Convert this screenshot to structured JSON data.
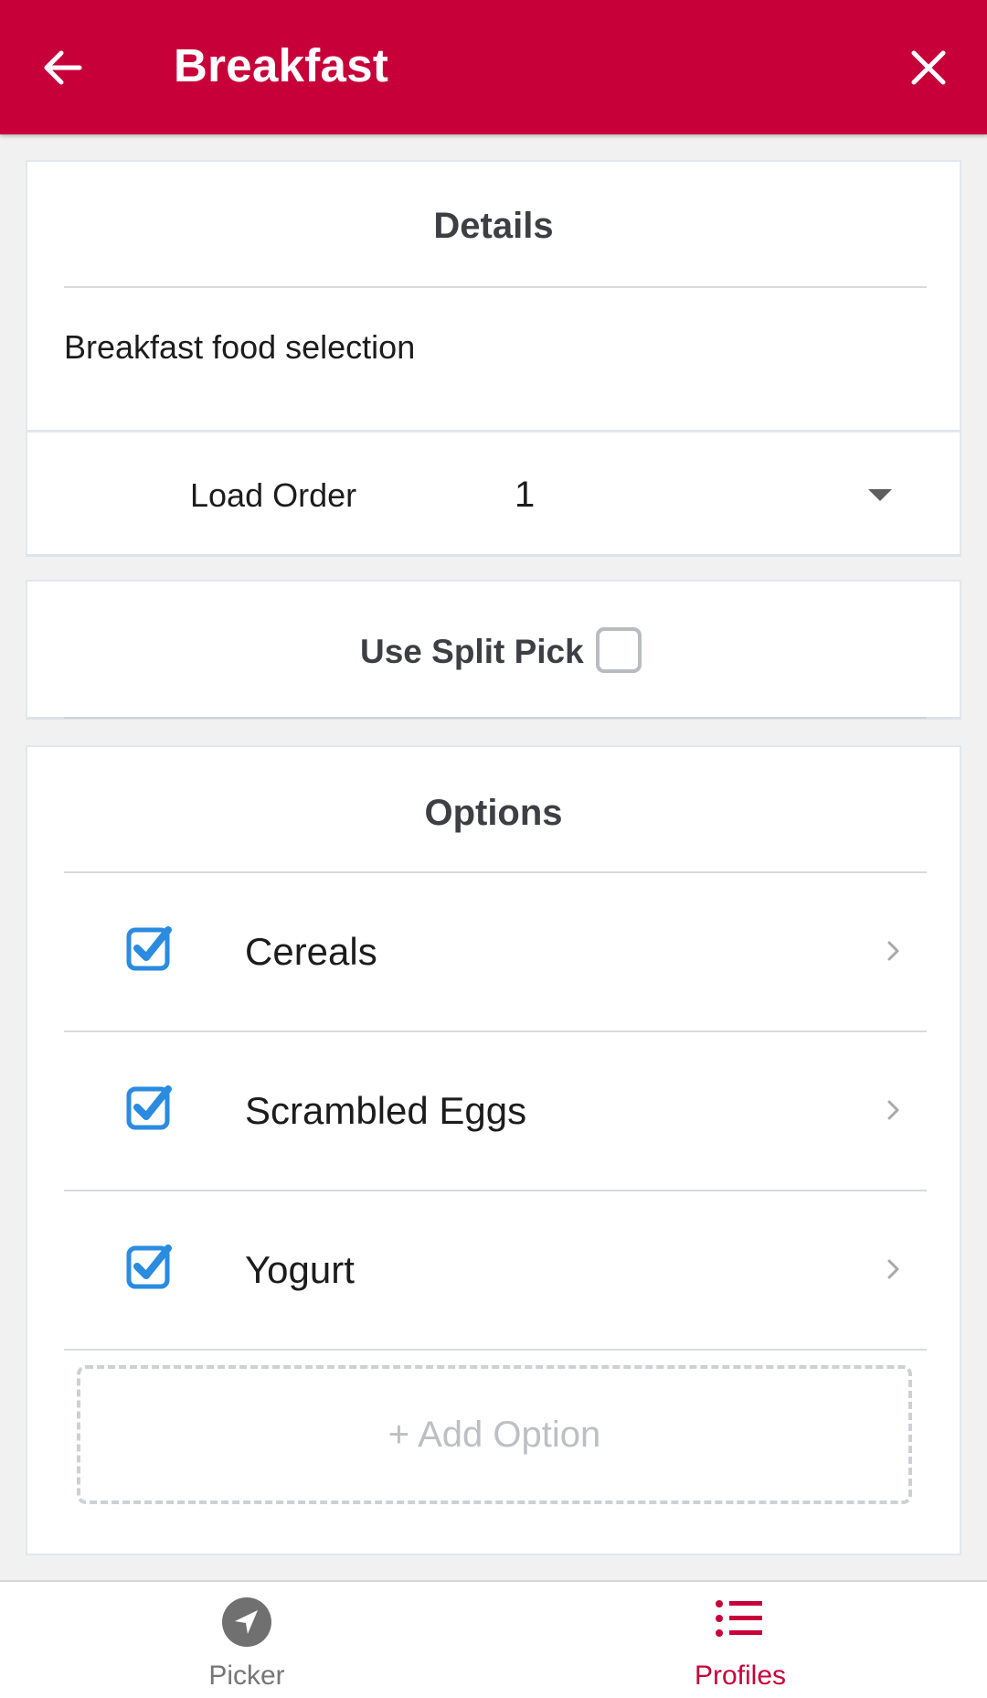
{
  "app_bar": {
    "title": "Breakfast",
    "back_icon": "arrow-left-icon",
    "close_icon": "close-icon",
    "background_color": "#c8003a"
  },
  "details": {
    "title": "Details",
    "description": "Breakfast food selection"
  },
  "load_order": {
    "label": "Load Order",
    "value": "1",
    "icon": "dropdown-arrow-icon"
  },
  "split_pick": {
    "label": "Use Split Pick",
    "checked": false
  },
  "options": {
    "title": "Options",
    "items": [
      {
        "label": "Cereals",
        "checked": true
      },
      {
        "label": "Scrambled Eggs",
        "checked": true
      },
      {
        "label": "Yogurt",
        "checked": true
      }
    ],
    "add_label": "+ Add Option",
    "check_color": "#2a8be0"
  },
  "bottom_nav": {
    "items": [
      {
        "label": "Picker",
        "icon": "navigation-arrow-icon",
        "active": false
      },
      {
        "label": "Profiles",
        "icon": "list-icon",
        "active": true
      }
    ],
    "active_color": "#c8003a"
  }
}
